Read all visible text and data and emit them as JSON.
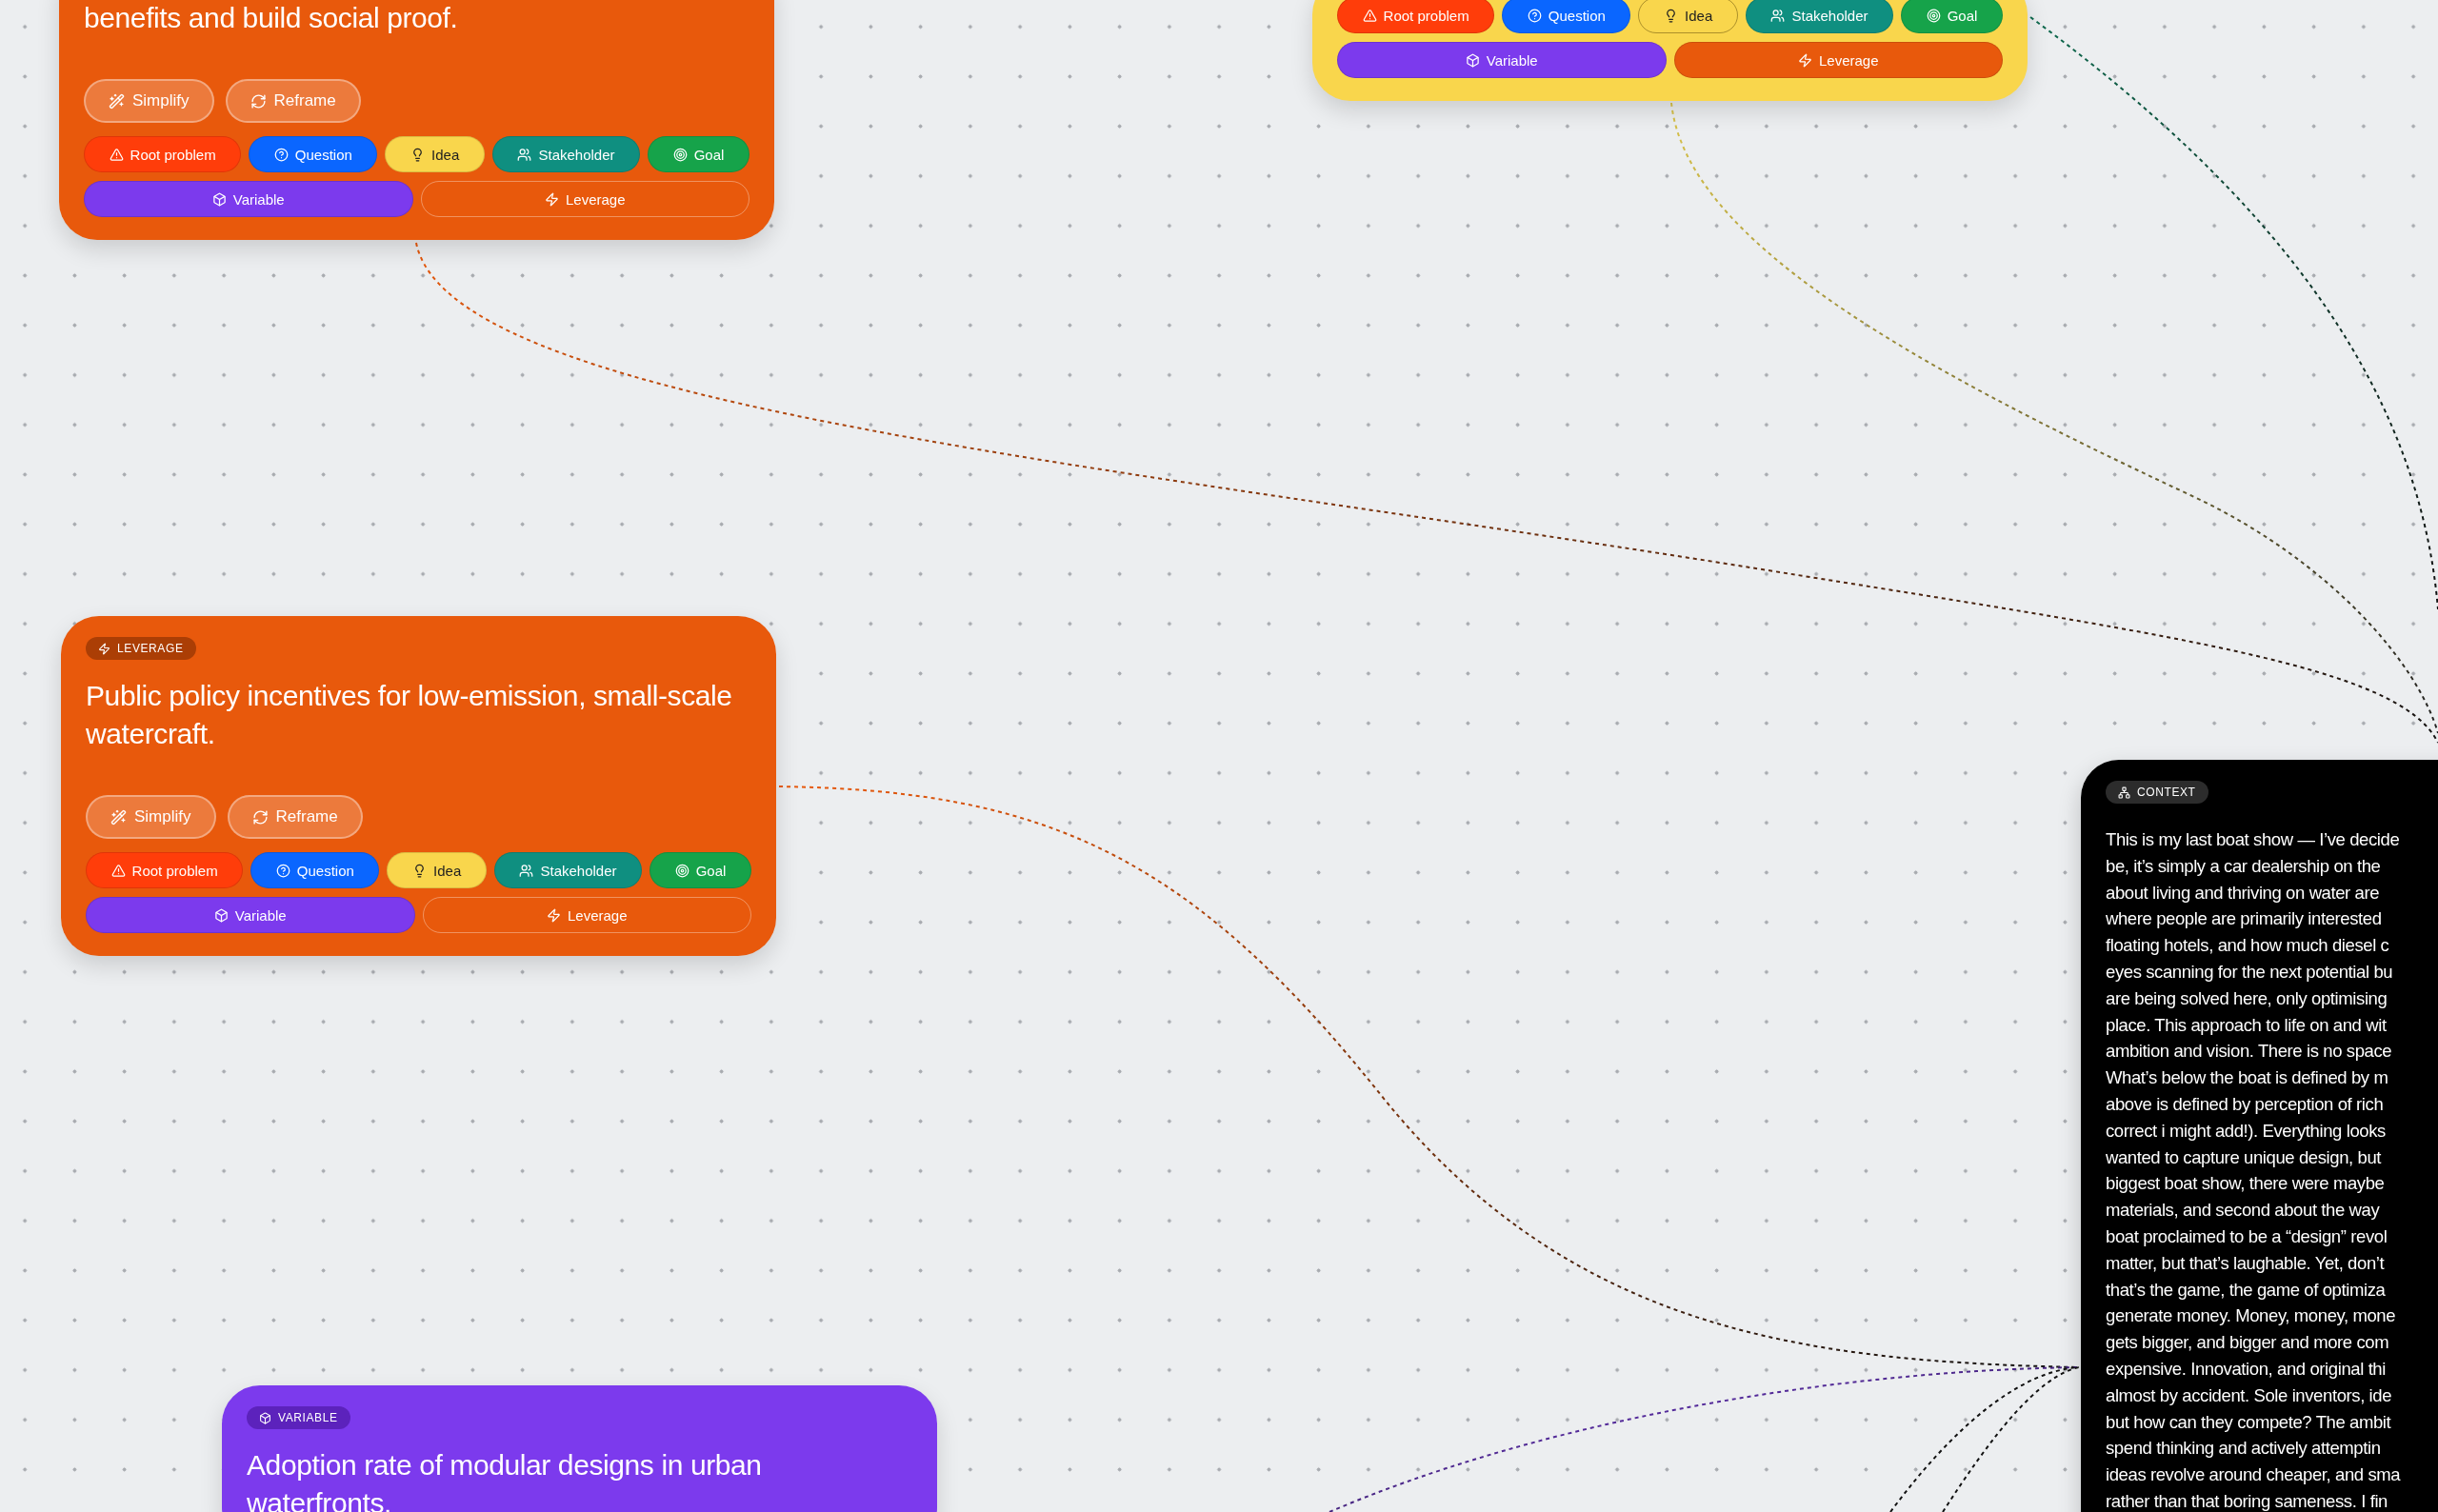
{
  "canvas": {
    "cards": [
      {
        "kind": "leverage",
        "title": "benefits and build social proof.",
        "actions": [
          {
            "kind": "simplify",
            "label": "Simplify"
          },
          {
            "kind": "reframe",
            "label": "Reframe"
          }
        ],
        "types": [
          {
            "kind": "root",
            "label": "Root problem",
            "selected": false
          },
          {
            "kind": "question",
            "label": "Question",
            "selected": false
          },
          {
            "kind": "idea",
            "label": "Idea",
            "selected": false
          },
          {
            "kind": "stakeholder",
            "label": "Stakeholder",
            "selected": false
          },
          {
            "kind": "goal",
            "label": "Goal",
            "selected": false
          },
          {
            "kind": "variable",
            "label": "Variable",
            "selected": false
          },
          {
            "kind": "leverage",
            "label": "Leverage",
            "selected": true
          }
        ]
      },
      {
        "kind": "idea",
        "types": [
          {
            "kind": "root",
            "label": "Root problem",
            "selected": false
          },
          {
            "kind": "question",
            "label": "Question",
            "selected": false
          },
          {
            "kind": "idea",
            "label": "Idea",
            "selected": true
          },
          {
            "kind": "stakeholder",
            "label": "Stakeholder",
            "selected": false
          },
          {
            "kind": "goal",
            "label": "Goal",
            "selected": false
          },
          {
            "kind": "variable",
            "label": "Variable",
            "selected": false
          },
          {
            "kind": "leverage",
            "label": "Leverage",
            "selected": false
          }
        ]
      },
      {
        "kind": "leverage",
        "badge": "LEVERAGE",
        "title": "Public policy incentives for low-emission, small-scale watercraft.",
        "actions": [
          {
            "kind": "simplify",
            "label": "Simplify"
          },
          {
            "kind": "reframe",
            "label": "Reframe"
          }
        ],
        "types": [
          {
            "kind": "root",
            "label": "Root problem",
            "selected": false
          },
          {
            "kind": "question",
            "label": "Question",
            "selected": false
          },
          {
            "kind": "idea",
            "label": "Idea",
            "selected": false
          },
          {
            "kind": "stakeholder",
            "label": "Stakeholder",
            "selected": false
          },
          {
            "kind": "goal",
            "label": "Goal",
            "selected": false
          },
          {
            "kind": "variable",
            "label": "Variable",
            "selected": false
          },
          {
            "kind": "leverage",
            "label": "Leverage",
            "selected": true
          }
        ]
      },
      {
        "kind": "variable",
        "badge": "VARIABLE",
        "title": "Adoption rate of modular designs in urban waterfronts."
      }
    ],
    "context": {
      "badge": "CONTEXT",
      "lines": [
        "This is my last boat show — I’ve decide",
        "be, it’s simply a car dealership on the",
        "about living and thriving on water are",
        "where people are primarily interested",
        "floating hotels, and how much diesel c",
        "eyes scanning for the next potential bu",
        "are being solved here, only optimising",
        "place. This approach to life on and wit",
        "ambition and vision. There is no space",
        "What’s below the boat is defined by m",
        "above is defined by perception of rich",
        "correct i might add!). Everything looks",
        "wanted to capture unique design, but",
        "biggest boat show, there were maybe",
        "materials, and second about the way",
        "boat proclaimed to be a “design” revol",
        "matter, but that’s laughable. Yet, don’t",
        "that’s the game, the game of optimiza",
        "generate money. Money, money, mone",
        "gets bigger, and bigger and more com",
        "expensive. Innovation, and original thi",
        "almost by accident. Sole inventors, ide",
        "but how can they compete? The ambit",
        "spend thinking and actively attemptin",
        "ideas revolve around cheaper, and sma",
        "rather than that boring sameness. I fin"
      ]
    }
  }
}
